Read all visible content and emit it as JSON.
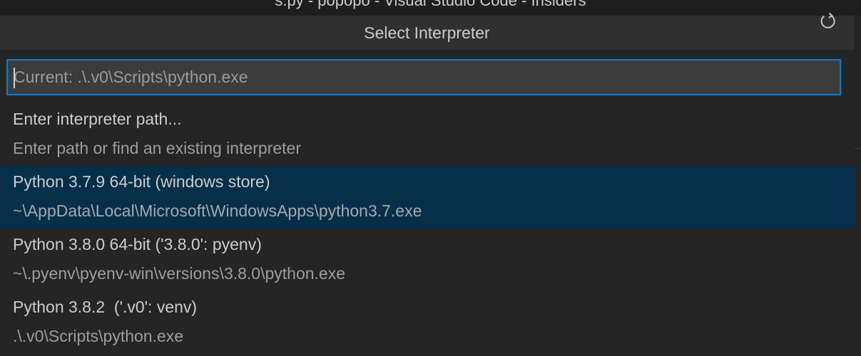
{
  "window": {
    "title": "s.py - popopo - Visual Studio Code - Insiders"
  },
  "quick_pick": {
    "title": "Select Interpreter",
    "refresh_icon": "refresh-icon",
    "input": {
      "value": "",
      "placeholder": "Current: .\\.v0\\Scripts\\python.exe"
    },
    "items": [
      {
        "label": "Enter interpreter path...",
        "detail": "Enter path or find an existing interpreter",
        "selected": false
      },
      {
        "label": "Python 3.7.9 64-bit (windows store)",
        "detail": "~\\AppData\\Local\\Microsoft\\WindowsApps\\python3.7.exe",
        "selected": true
      },
      {
        "label": "Python 3.8.0 64-bit ('3.8.0': pyenv)",
        "detail": "~\\.pyenv\\pyenv-win\\versions\\3.8.0\\python.exe",
        "selected": false
      },
      {
        "label": "Python 3.8.2  ('.v0': venv)",
        "detail": ".\\.v0\\Scripts\\python.exe",
        "selected": false
      }
    ]
  },
  "colors": {
    "background": "#252526",
    "header": "#303031",
    "selected_item": "#062f4a",
    "input_focus_border": "#007fd4"
  }
}
